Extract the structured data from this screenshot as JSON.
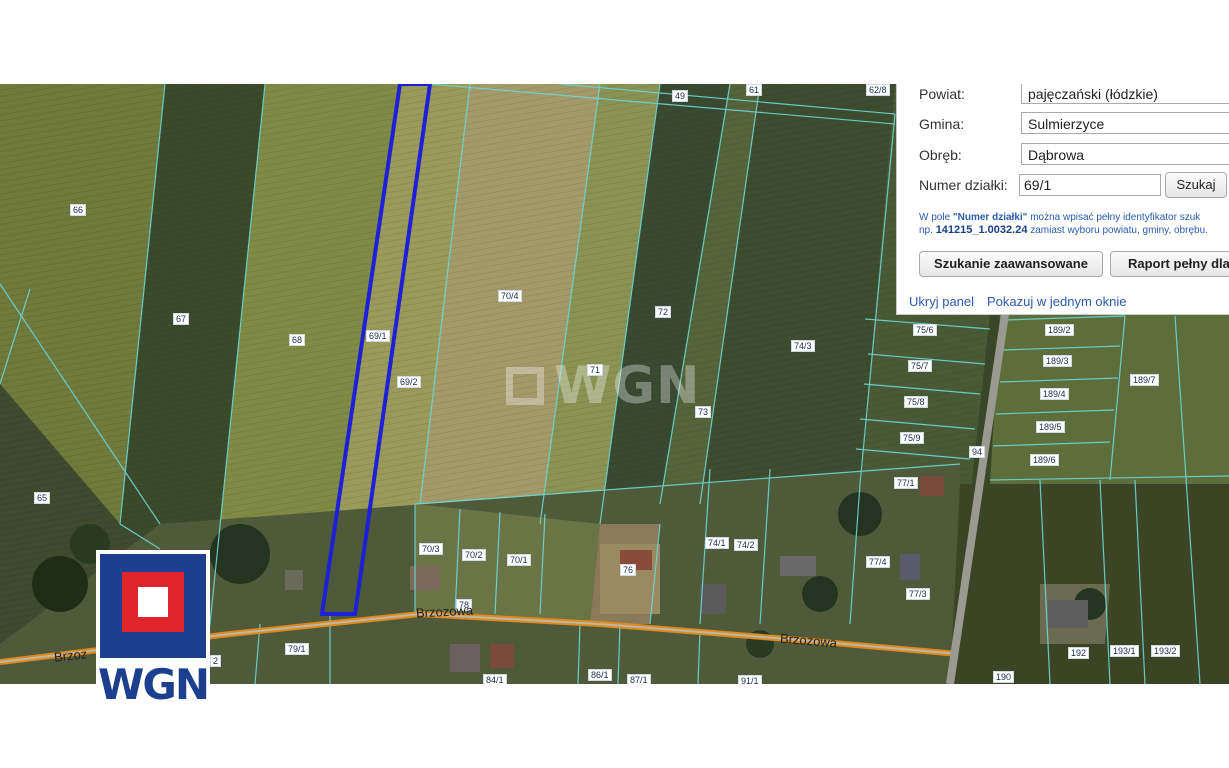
{
  "panel": {
    "fields": [
      {
        "label": "Powiat:",
        "value": "pajęczański (łódzkie)"
      },
      {
        "label": "Gmina:",
        "value": "Sulmierzyce"
      },
      {
        "label": "Obręb:",
        "value": "Dąbrowa"
      }
    ],
    "parcel_number_label": "Numer działki:",
    "parcel_number_value": "69/1",
    "search_button": "Szukaj",
    "hint_line1_prefix": "W pole ",
    "hint_line1_bold": "\"Numer działki\"",
    "hint_line1_suffix": " można wpisać pełny identyfikator szuk",
    "hint_line2_prefix": "np. ",
    "hint_line2_id": "141215_1.0032.24",
    "hint_line2_suffix": " zamiast wyboru powiatu, gminy, obrębu.",
    "advanced_search_button": "Szukanie zaawansowane",
    "full_report_button": "Raport pełny dla",
    "hide_panel_link": "Ukryj panel",
    "show_single_window_link": "Pokazuj w jednym oknie"
  },
  "map": {
    "watermark": "WGN",
    "selected_parcel": "69/1",
    "road_name": "Brzozowa",
    "road_label_left": "Brzoz",
    "parcel_labels": [
      "61",
      "62/8",
      "49",
      "66",
      "67",
      "68",
      "69/1",
      "69/2",
      "70/4",
      "72",
      "71",
      "73",
      "74/3",
      "65",
      "70/3",
      "70/2",
      "70/1",
      "78",
      "79/1",
      "74/1",
      "74/2",
      "76",
      "77/1",
      "77/4",
      "77/3",
      "75/6",
      "75/7",
      "75/8",
      "75/9",
      "94",
      "189/2",
      "189/3",
      "189/4",
      "189/5",
      "189/6",
      "189/7",
      "192",
      "193/1",
      "193/2",
      "190",
      "84/1",
      "86/1",
      "87/1",
      "91/1",
      "2"
    ]
  },
  "logo": {
    "text": "WGN"
  },
  "colors": {
    "selected_parcel": "#1f1fd6",
    "road": "#e08a1a",
    "parcel_border": "#6fd6d6"
  }
}
